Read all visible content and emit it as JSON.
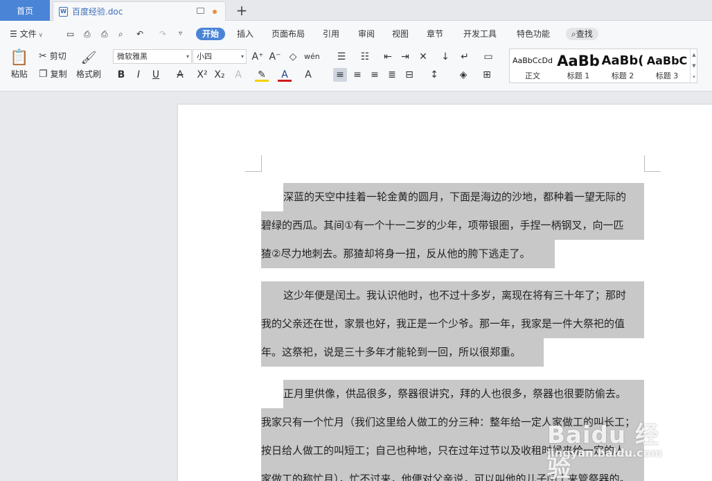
{
  "tabs": {
    "home": "首页",
    "document": "百度经验.doc"
  },
  "menu": {
    "file": "文件",
    "items": [
      "开始",
      "插入",
      "页面布局",
      "引用",
      "审阅",
      "视图",
      "章节",
      "开发工具",
      "特色功能"
    ],
    "active": "开始",
    "search": "查找"
  },
  "clipboard": {
    "paste": "粘贴",
    "cut": "剪切",
    "copy": "复制",
    "format_painter": "格式刷"
  },
  "font": {
    "family": "微软雅黑",
    "size": "小四"
  },
  "styles": [
    {
      "sample": "AaBbCcDd",
      "label": "正文"
    },
    {
      "sample": "AaBb",
      "label": "标题 1"
    },
    {
      "sample": "AaBb(",
      "label": "标题 2"
    },
    {
      "sample": "AaBbC",
      "label": "标题 3"
    }
  ],
  "document": {
    "paragraphs": [
      {
        "lines": [
          "深蓝的天空中挂着一轮金黄的圆月，下面是海边的沙地，都种着一望无际的",
          "碧绿的西瓜。其间①有一个十一二岁的少年，项带银圈，手捏一柄钢叉，向一匹",
          "猹②尽力地刺去。那猹却将身一扭，反从他的胯下逃走了。"
        ]
      },
      {
        "lines": [
          "这少年便是闰土。我认识他时，也不过十多岁，离现在将有三十年了；那时",
          "我的父亲还在世，家景也好，我正是一个少爷。那一年，我家是一件大祭祀的值",
          "年。这祭祀，说是三十多年才能轮到一回，所以很郑重。"
        ]
      },
      {
        "lines": [
          "正月里供像，供品很多，祭器很讲究，拜的人也很多，祭器也很要防偷去。",
          "我家只有一个忙月（我们这里给人做工的分三种：整年给一定人家做工的叫长工；",
          "按日给人做工的叫短工；自己也种地，只在过年过节以及收租时候来给一定的人",
          "家做工的称忙月），忙不过来，他便对父亲说，可以叫他的儿子闰土来管祭器的。"
        ]
      }
    ]
  },
  "watermark": {
    "main": "Baidu 经验",
    "sub": "jingyan.baidu.com"
  }
}
